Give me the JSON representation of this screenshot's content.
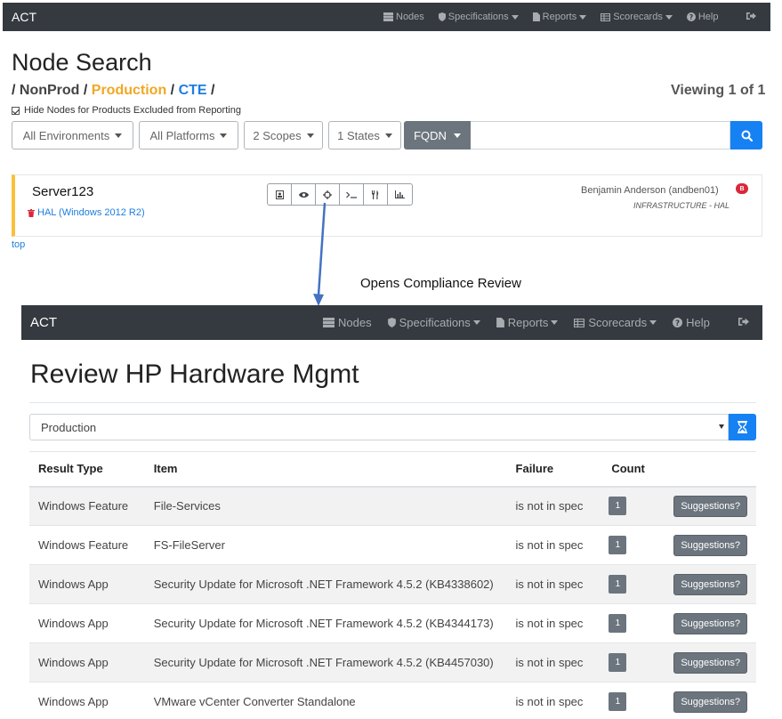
{
  "nav_top": {
    "brand": "ACT",
    "items": [
      {
        "label": "Nodes",
        "icon": "server-icon",
        "dropdown": false
      },
      {
        "label": "Specifications",
        "icon": "shield-icon",
        "dropdown": true
      },
      {
        "label": "Reports",
        "icon": "file-icon",
        "dropdown": true
      },
      {
        "label": "Scorecards",
        "icon": "table-icon",
        "dropdown": true
      },
      {
        "label": "Help",
        "icon": "question-circle-icon",
        "dropdown": false
      }
    ],
    "logout_icon": "sign-out-icon"
  },
  "search_page": {
    "title": "Node Search",
    "breadcrumb": [
      {
        "label": "NonProd",
        "color": "#444444"
      },
      {
        "label": "Production",
        "color": "#f0a823"
      },
      {
        "label": "CTE",
        "color": "#1d7ee0"
      }
    ],
    "viewing": "Viewing 1 of 1",
    "hide_nodes_label": "Hide Nodes for Products Excluded from Reporting",
    "hide_nodes_checked": true,
    "filters": [
      "All Environments",
      "All Platforms",
      "2 Scopes",
      "1 States"
    ],
    "search_type": "FQDN",
    "search_value": "",
    "search_icon": "search-icon"
  },
  "node": {
    "name": "Server123",
    "platform": "HAL (Windows 2012 R2)",
    "owner": "Benjamin Anderson (andben01)",
    "org": "INFRASTRUCTURE - HAL",
    "badge": "B",
    "action_icons": [
      "id-card-icon",
      "eye-icon",
      "crosshairs-icon",
      "terminal-icon",
      "utensils-icon",
      "bar-chart-icon"
    ]
  },
  "top_link": "top",
  "annotation": "Opens Compliance Review",
  "nav_second": {
    "brand": "ACT",
    "items": [
      {
        "label": "Nodes",
        "icon": "server-icon",
        "dropdown": false
      },
      {
        "label": "Specifications",
        "icon": "shield-icon",
        "dropdown": true
      },
      {
        "label": "Reports",
        "icon": "file-icon",
        "dropdown": true
      },
      {
        "label": "Scorecards",
        "icon": "table-icon",
        "dropdown": true
      },
      {
        "label": "Help",
        "icon": "question-circle-icon",
        "dropdown": false
      }
    ],
    "logout_icon": "sign-out-icon"
  },
  "review": {
    "title": "Review HP Hardware Mgmt",
    "environment": "Production",
    "hourglass_icon": "hourglass-icon",
    "columns": [
      "Result Type",
      "Item",
      "Failure",
      "Count"
    ],
    "rows": [
      {
        "type": "Windows Feature",
        "item": "File-Services",
        "failure": "is not in spec",
        "count": "1",
        "action": "Suggestions?"
      },
      {
        "type": "Windows Feature",
        "item": "FS-FileServer",
        "failure": "is not in spec",
        "count": "1",
        "action": "Suggestions?"
      },
      {
        "type": "Windows App",
        "item": "Security Update for Microsoft .NET Framework 4.5.2 (KB4338602)",
        "failure": "is not in spec",
        "count": "1",
        "action": "Suggestions?"
      },
      {
        "type": "Windows App",
        "item": "Security Update for Microsoft .NET Framework 4.5.2 (KB4344173)",
        "failure": "is not in spec",
        "count": "1",
        "action": "Suggestions?"
      },
      {
        "type": "Windows App",
        "item": "Security Update for Microsoft .NET Framework 4.5.2 (KB4457030)",
        "failure": "is not in spec",
        "count": "1",
        "action": "Suggestions?"
      },
      {
        "type": "Windows App",
        "item": "VMware vCenter Converter Standalone",
        "failure": "is not in spec",
        "count": "1",
        "action": "Suggestions?"
      }
    ]
  }
}
